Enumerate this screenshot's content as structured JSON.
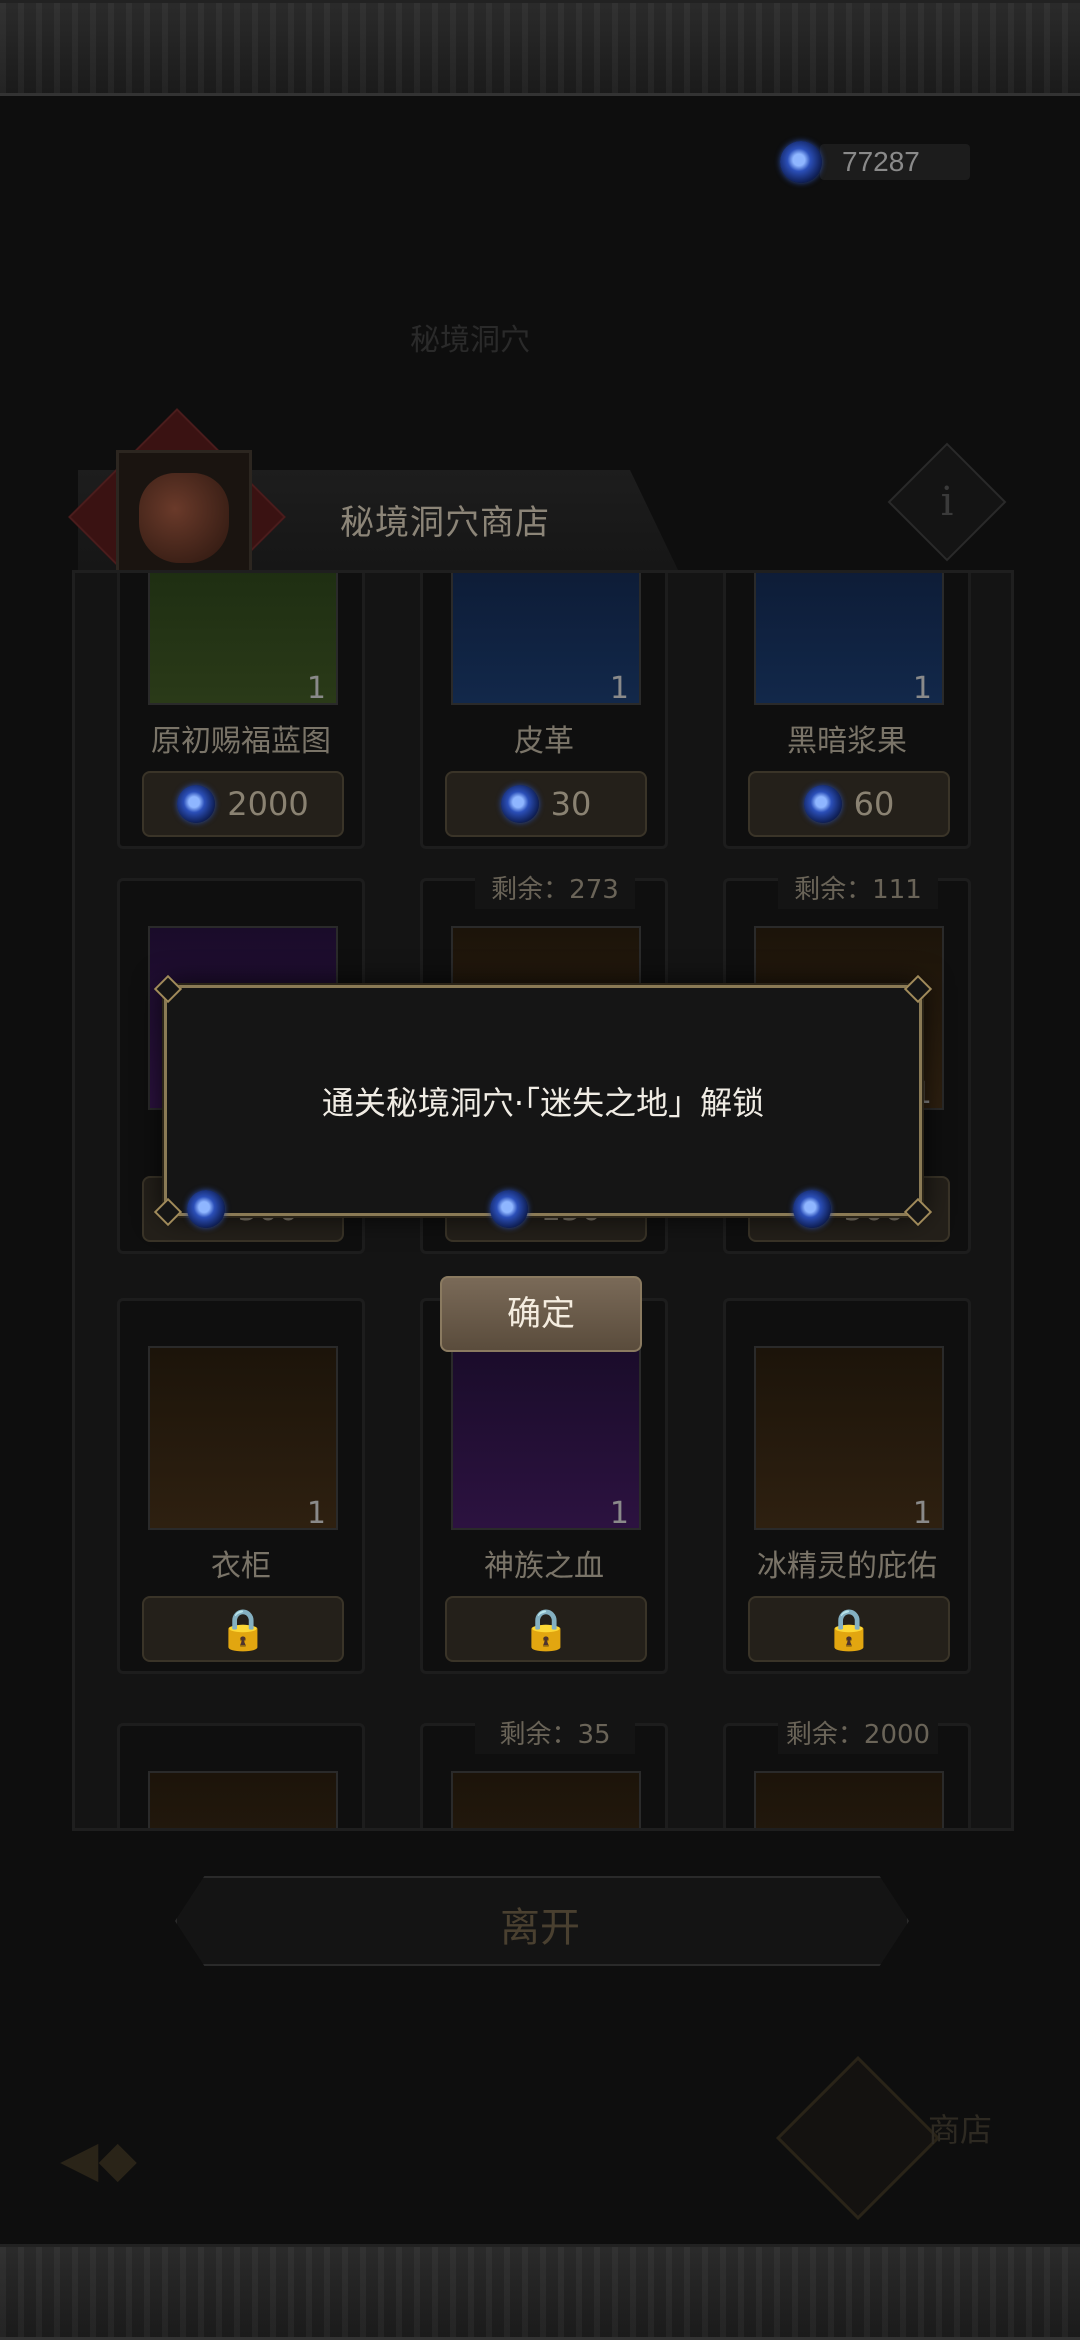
{
  "currency": {
    "icon": "blue-orb-icon",
    "value": "77287"
  },
  "background": {
    "faint_title": "秘境洞穴"
  },
  "shop": {
    "title": "秘境洞穴商店",
    "info_icon": "i"
  },
  "items": [
    {
      "name": "原初赐福蓝图",
      "count": "1",
      "price": "2000",
      "remain": ""
    },
    {
      "name": "皮革",
      "count": "1",
      "price": "30",
      "remain": ""
    },
    {
      "name": "黑暗浆果",
      "count": "1",
      "price": "60",
      "remain": ""
    },
    {
      "name": "",
      "count": "",
      "price": "500",
      "remain": ""
    },
    {
      "name": "",
      "count": "",
      "price": "150",
      "remain": "剩余：273"
    },
    {
      "name": "",
      "count": "1",
      "price": "500",
      "remain": "剩余：111"
    },
    {
      "name": "衣柜",
      "count": "1",
      "price": "",
      "remain": ""
    },
    {
      "name": "神族之血",
      "count": "1",
      "price": "",
      "remain": ""
    },
    {
      "name": "冰精灵的庇佑",
      "count": "1",
      "price": "",
      "remain": ""
    },
    {
      "remain": ""
    },
    {
      "remain": "剩余：35"
    },
    {
      "remain": "剩余：2000"
    }
  ],
  "dialog": {
    "message": "通关秘境洞穴·「迷失之地」解锁",
    "confirm_label": "确定"
  },
  "footer": {
    "leave_label": "离开",
    "shop_label": "商店"
  }
}
